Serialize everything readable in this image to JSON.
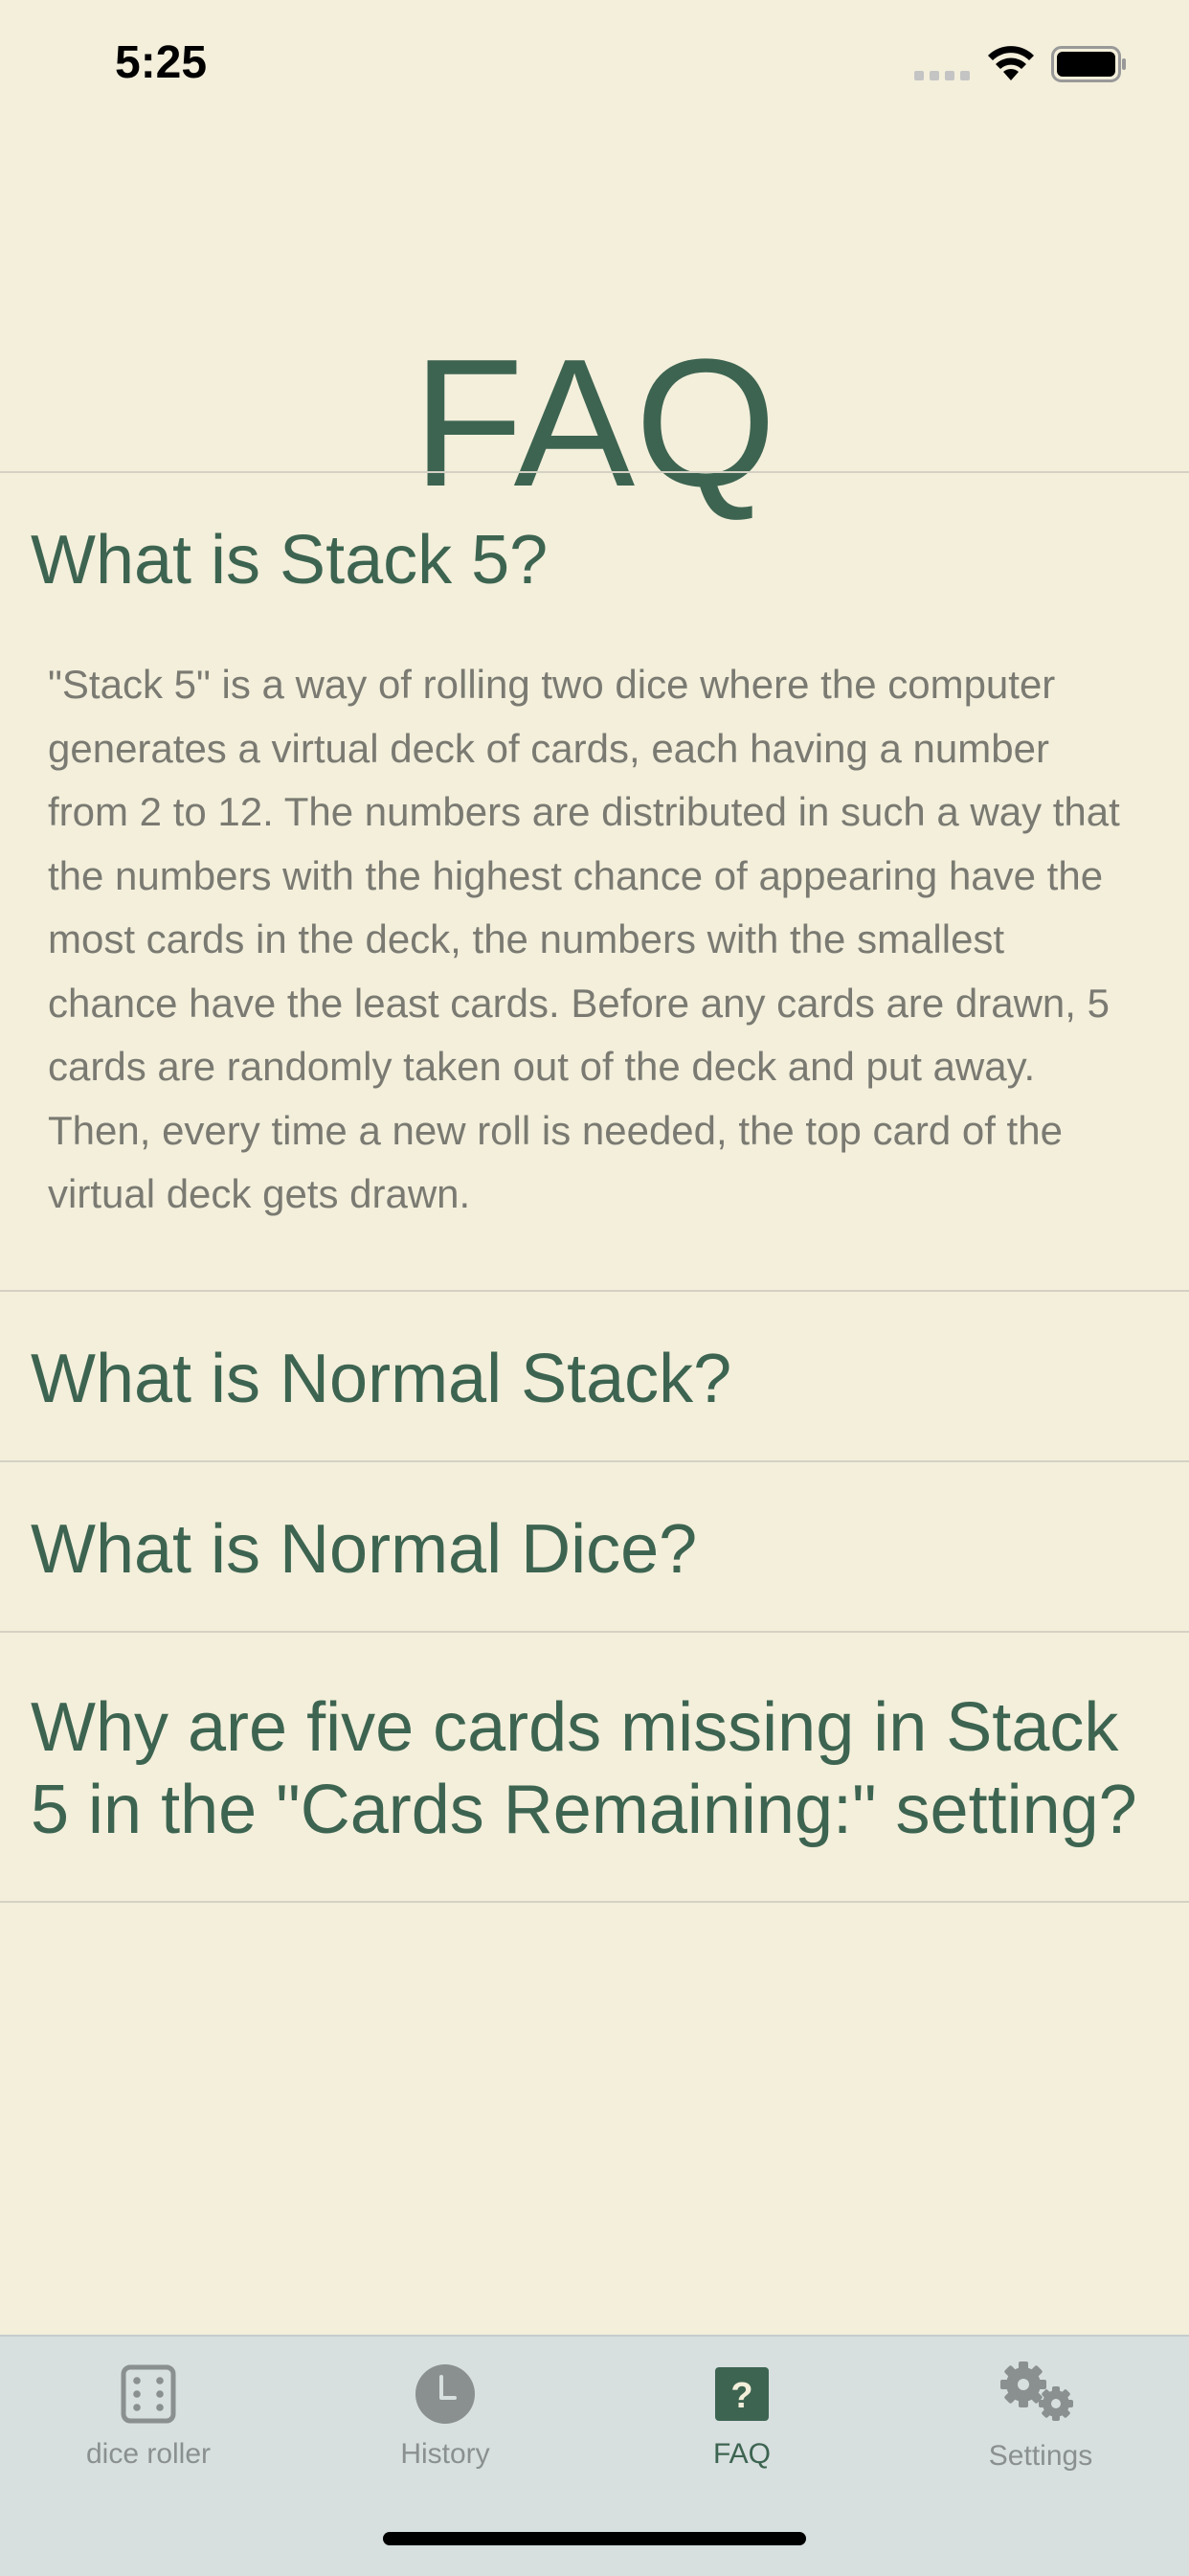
{
  "status": {
    "time": "5:25"
  },
  "page": {
    "title": "FAQ"
  },
  "faq": [
    {
      "question": "What is Stack 5?",
      "answer": "\"Stack 5\" is a way of rolling two dice where the computer generates a virtual deck of cards, each having a number from 2 to 12. The numbers are distributed in such a way that the numbers with the highest chance of appearing have the most cards in the deck, the numbers with the smallest chance have the least cards. Before any cards are drawn, 5 cards are randomly taken out of the deck and put away. Then, every time a new roll is needed, the top card of the virtual deck gets drawn.",
      "expanded": true
    },
    {
      "question": "What is Normal Stack?",
      "expanded": false
    },
    {
      "question": "What is Normal Dice?",
      "expanded": false
    },
    {
      "question": "Why are five cards missing in Stack 5 in the \"Cards Remaining:\" setting?",
      "expanded": false
    }
  ],
  "tabs": [
    {
      "label": "dice roller",
      "icon": "dice-icon",
      "active": false
    },
    {
      "label": "History",
      "icon": "clock-icon",
      "active": false
    },
    {
      "label": "FAQ",
      "icon": "question-icon",
      "active": true
    },
    {
      "label": "Settings",
      "icon": "gear-icon",
      "active": false
    }
  ],
  "colors": {
    "background": "#f3efdb",
    "accent": "#3d6451",
    "answer_text": "#7a7a72",
    "tab_bar": "#d7dfdf",
    "tab_inactive": "#8a908f"
  }
}
